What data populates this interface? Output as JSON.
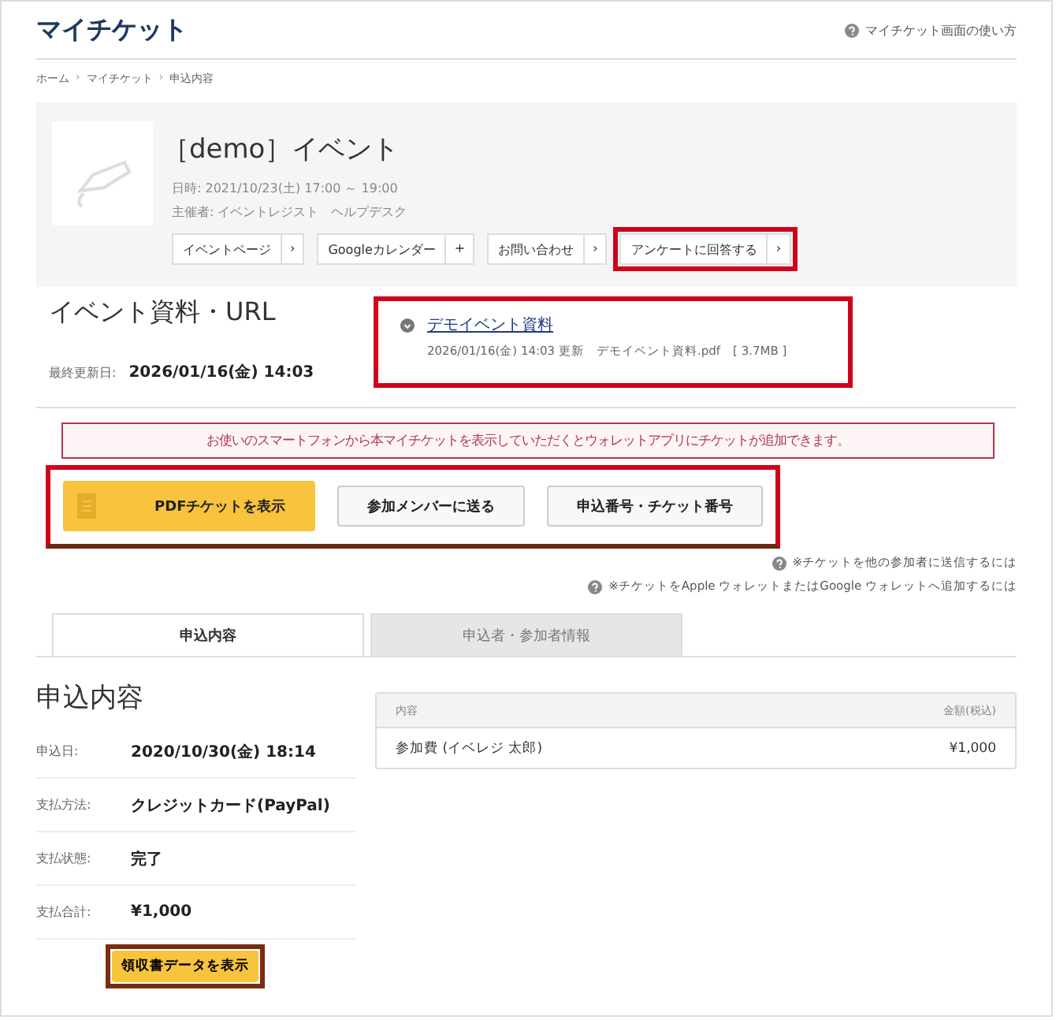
{
  "header": {
    "title": "マイチケット",
    "help_link": "マイチケット画面の使い方"
  },
  "breadcrumb": [
    "ホーム",
    "マイチケット",
    "申込内容"
  ],
  "event": {
    "title": "［demo］イベント",
    "date": "日時: 2021/10/23(土) 17:00 ～ 19:00",
    "organizer": "主催者: イベントレジスト　ヘルプデスク",
    "links": [
      {
        "label": "イベントページ",
        "icon": "›",
        "highlighted": false
      },
      {
        "label": "Googleカレンダー",
        "icon": "+",
        "highlighted": false
      },
      {
        "label": "お問い合わせ",
        "icon": "›",
        "highlighted": false
      },
      {
        "label": "アンケートに回答する",
        "icon": "›",
        "highlighted": true
      }
    ]
  },
  "materials": {
    "heading": "イベント資料・URL",
    "updated_label": "最終更新日:",
    "updated_value": "2026/01/16(金) 14:03",
    "file": {
      "name": "デモイベント資料",
      "updated": "2026/01/16(金) 14:03 更新",
      "filename": "デモイベント資料.pdf",
      "size": "[ 3.7MB ]",
      "highlighted": true
    }
  },
  "notice": "お使いのスマートフォンから本マイチケットを表示していただくとウォレットアプリにチケットが追加できます。",
  "ticket_actions": {
    "highlighted": true,
    "buttons": [
      {
        "label": "PDFチケットを表示",
        "kind": "primary"
      },
      {
        "label": "参加メンバーに送る",
        "kind": "secondary"
      },
      {
        "label": "申込番号・チケット番号",
        "kind": "secondary"
      }
    ]
  },
  "help_notes": [
    "※チケットを他の参加者に送信するには",
    "※チケットをApple ウォレットまたはGoogle ウォレットへ追加するには"
  ],
  "tabs": [
    {
      "label": "申込内容",
      "selected": true
    },
    {
      "label": "申込者・参加者情報",
      "selected": false
    }
  ],
  "order": {
    "heading": "申込内容",
    "rows": [
      {
        "label": "申込日:",
        "value": "2020/10/30(金) 18:14"
      },
      {
        "label": "支払方法:",
        "value": "クレジットカード(PayPal)"
      },
      {
        "label": "支払状態:",
        "value": "完了"
      },
      {
        "label": "支払合計:",
        "value": "¥1,000"
      }
    ],
    "receipt_button": {
      "label": "領収書データを表示",
      "highlighted": true
    }
  },
  "items_table": {
    "columns": [
      "内容",
      "金額(税込)"
    ],
    "rows": [
      [
        "参加費 (イベレジ 太郎)",
        "¥1,000"
      ]
    ]
  }
}
